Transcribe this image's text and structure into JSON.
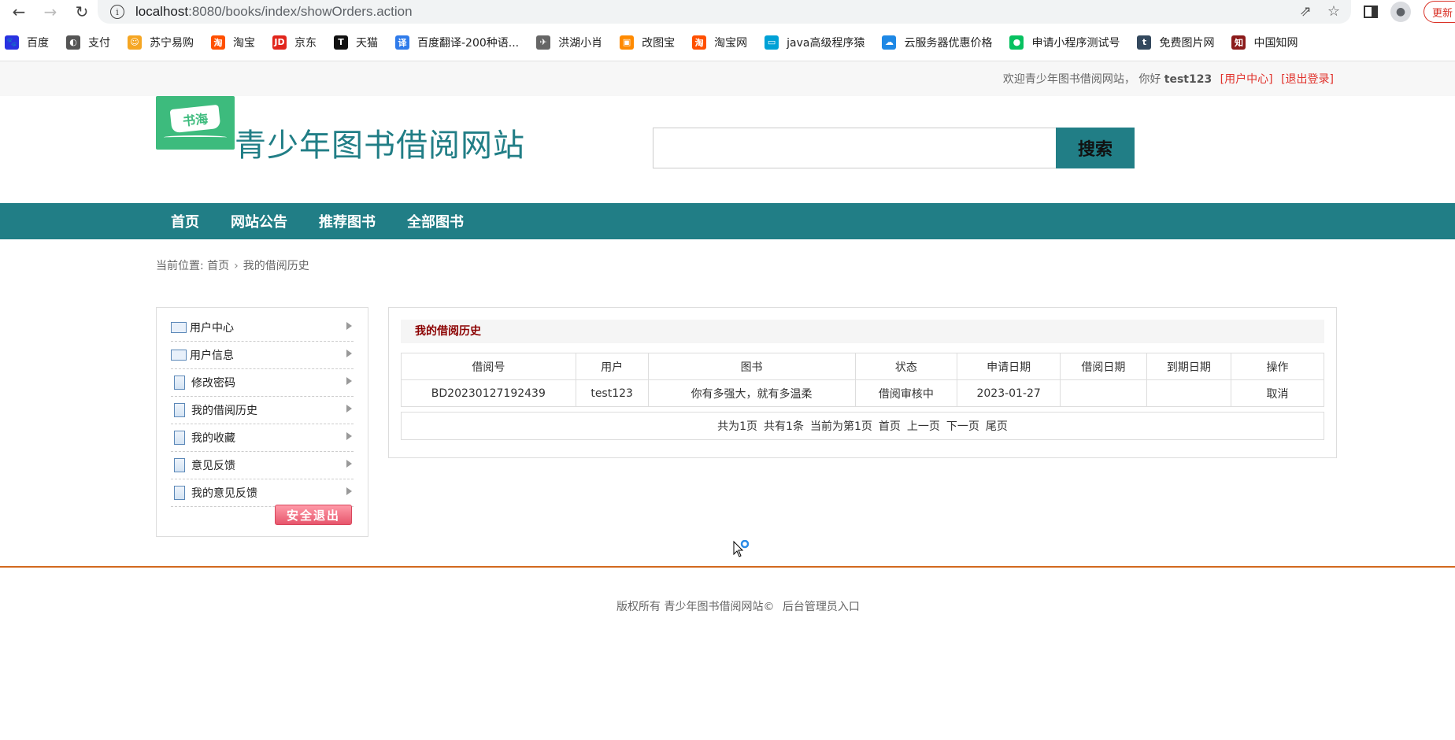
{
  "browser": {
    "url_host": "localhost",
    "url_path": ":8080/books/index/showOrders.action",
    "update_label": "更新"
  },
  "bookmarks": [
    {
      "label": "百度",
      "color": "#2932e1",
      "glyph": "🐾"
    },
    {
      "label": "支付",
      "color": "#555555",
      "glyph": "◐"
    },
    {
      "label": "苏宁易购",
      "color": "#f5a623",
      "glyph": "☺"
    },
    {
      "label": "淘宝",
      "color": "#ff5000",
      "glyph": "淘"
    },
    {
      "label": "京东",
      "color": "#e1251b",
      "glyph": "JD"
    },
    {
      "label": "天猫",
      "color": "#111111",
      "glyph": "T"
    },
    {
      "label": "百度翻译-200种语...",
      "color": "#2f7bea",
      "glyph": "译"
    },
    {
      "label": "洪湖小肖",
      "color": "#666666",
      "glyph": "✈"
    },
    {
      "label": "改图宝",
      "color": "#ff8a00",
      "glyph": "▣"
    },
    {
      "label": "淘宝网",
      "color": "#ff5000",
      "glyph": "淘"
    },
    {
      "label": "java高级程序猿",
      "color": "#00a1d6",
      "glyph": "▭"
    },
    {
      "label": "云服务器优惠价格",
      "color": "#1e88e5",
      "glyph": "☁"
    },
    {
      "label": "申请小程序测试号",
      "color": "#07c160",
      "glyph": "●"
    },
    {
      "label": "免费图片网",
      "color": "#34495e",
      "glyph": "t"
    },
    {
      "label": "中国知网",
      "color": "#8b1a1a",
      "glyph": "知"
    }
  ],
  "topbar": {
    "welcome": "欢迎青少年图书借阅网站，  你好",
    "username": "test123",
    "user_center": "[用户中心]",
    "logout": "[退出登录]"
  },
  "header": {
    "logo_text": "书海",
    "site_title": "青少年图书借阅网站",
    "search_placeholder": "",
    "search_button": "搜索"
  },
  "nav": [
    "首页",
    "网站公告",
    "推荐图书",
    "全部图书"
  ],
  "breadcrumb": {
    "prefix": "当前位置:",
    "home": "首页",
    "current": "我的借阅历史"
  },
  "sidebar": {
    "items": [
      {
        "label": "用户中心",
        "icon": "id-card-icon"
      },
      {
        "label": "用户信息",
        "icon": "id-card-icon"
      },
      {
        "label": "修改密码",
        "icon": "document-icon"
      },
      {
        "label": "我的借阅历史",
        "icon": "document-icon"
      },
      {
        "label": "我的收藏",
        "icon": "document-icon"
      },
      {
        "label": "意见反馈",
        "icon": "document-icon"
      },
      {
        "label": "我的意见反馈",
        "icon": "document-icon"
      }
    ],
    "logout_button": "安全退出"
  },
  "main": {
    "title": "我的借阅历史",
    "columns": [
      "借阅号",
      "用户",
      "图书",
      "状态",
      "申请日期",
      "借阅日期",
      "到期日期",
      "操作"
    ],
    "rows": [
      [
        "BD20230127192439",
        "test123",
        "你有多强大，就有多温柔",
        "借阅审核中",
        "2023-01-27",
        "",
        "",
        "取消"
      ]
    ],
    "pager": {
      "total_pages": "共为1页",
      "total_items": "共有1条",
      "current": "当前为第1页",
      "first": "首页",
      "prev": "上一页",
      "next": "下一页",
      "last": "尾页"
    }
  },
  "footer": {
    "copyright": "版权所有 青少年图书借阅网站©",
    "admin_link": "后台管理员入口"
  }
}
